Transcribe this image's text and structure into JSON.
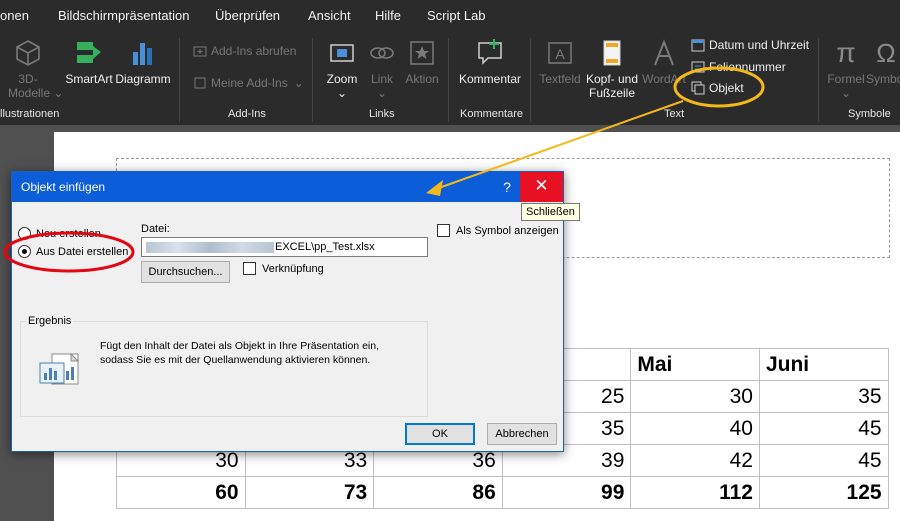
{
  "tabs": [
    "onen",
    "Bildschirmpräsentation",
    "Überprüfen",
    "Ansicht",
    "Hilfe",
    "Script Lab"
  ],
  "ribbon": {
    "models_line1": "3D-",
    "models_line2": "Modelle",
    "smartart": "SmartArt",
    "diagramm": "Diagramm",
    "group_illustrationen": "llustrationen",
    "addins_abrufen": "Add-Ins abrufen",
    "meine_addins": "Meine Add-Ins",
    "group_addins": "Add-Ins",
    "zoom": "Zoom",
    "link": "Link",
    "aktion": "Aktion",
    "group_links": "Links",
    "kommentar": "Kommentar",
    "group_kommentare": "Kommentare",
    "textfeld": "Textfeld",
    "kopf_line1": "Kopf- und",
    "kopf_line2": "Fußzeile",
    "wordart": "WordArt",
    "datum": "Datum und Uhrzeit",
    "folie": "Foliennummer",
    "objekt": "Objekt",
    "group_text": "Text",
    "formel": "Formel",
    "symbol": "Symbol",
    "group_symbole": "Symbole",
    "dropdown_glyph": "⌄",
    "sigma_glyph": "π",
    "omega_glyph": "Ω"
  },
  "table": {
    "headers": [
      "",
      "",
      "",
      "",
      "Mai",
      "Juni"
    ],
    "rows": [
      [
        "",
        "",
        "",
        "25",
        "30",
        "35"
      ],
      [
        "",
        "",
        "",
        "35",
        "40",
        "45"
      ],
      [
        "30",
        "33",
        "36",
        "39",
        "42",
        "45"
      ],
      [
        "60",
        "73",
        "86",
        "99",
        "112",
        "125"
      ]
    ]
  },
  "dialog": {
    "title": "Objekt einfügen",
    "help": "?",
    "close": "✕",
    "radio_new": "Neu erstellen",
    "radio_file": "Aus Datei erstellen",
    "file_label": "Datei:",
    "file_value": "EXCEL\\pp_Test.xlsx",
    "browse": "Durchsuchen...",
    "link": "Verknüpfung",
    "as_symbol": "Als Symbol anzeigen",
    "result_legend": "Ergebnis",
    "result_text": "Fügt den Inhalt der Datei als Objekt in Ihre Präsentation ein, sodass Sie es mit der Quellanwendung aktivieren können.",
    "ok": "OK",
    "cancel": "Abbrechen"
  },
  "tooltip": "Schließen",
  "colors": {
    "ribbon_bg": "#2b2b2b",
    "accent_blue": "#0b5ed7",
    "close_red": "#e81123",
    "annotation_yellow": "#f5b819",
    "annotation_red": "#e30613"
  }
}
